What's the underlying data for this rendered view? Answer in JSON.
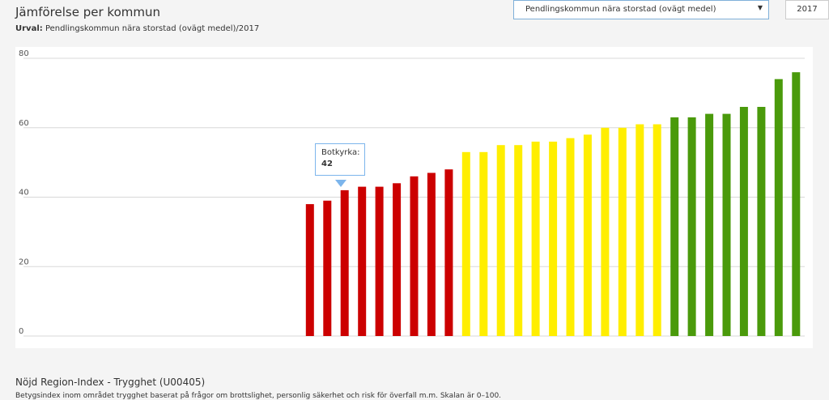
{
  "header": {
    "title": "Jämförelse per kommun",
    "subtitle_label": "Urval:",
    "subtitle_value": "Pendlingskommun nära storstad (ovägt medel)/2017"
  },
  "controls": {
    "group_select": "Pendlingskommun nära storstad (ovägt medel)",
    "year_select": "2017"
  },
  "tooltip": {
    "name": "Botkyrka:",
    "value": "42"
  },
  "footer": {
    "title": "Nöjd Region-Index - Trygghet (U00405)",
    "text": "Betygsindex inom området trygghet baserat på frågor om brottslighet, personlig säkerhet och risk för överfall m.m. Skalan är 0–100."
  },
  "chart_data": {
    "type": "bar",
    "title": "",
    "xlabel": "",
    "ylabel": "",
    "ylim": [
      0,
      80
    ],
    "yticks": [
      0,
      20,
      40,
      60,
      80
    ],
    "grid": true,
    "colors": {
      "red": "#cc0000",
      "yellow": "#ffee00",
      "green": "#4a9a0b"
    },
    "values": [
      null,
      null,
      null,
      null,
      null,
      null,
      null,
      null,
      null,
      null,
      null,
      null,
      null,
      null,
      null,
      null,
      38,
      39,
      42,
      43,
      43,
      44,
      46,
      47,
      48,
      53,
      53,
      55,
      55,
      56,
      56,
      57,
      58,
      60,
      60,
      61,
      61,
      63,
      63,
      64,
      64,
      66,
      66,
      74,
      76
    ],
    "color_groups": [
      "none",
      "none",
      "none",
      "none",
      "none",
      "none",
      "none",
      "none",
      "none",
      "none",
      "none",
      "none",
      "none",
      "none",
      "none",
      "none",
      "red",
      "red",
      "red",
      "red",
      "red",
      "red",
      "red",
      "red",
      "red",
      "yellow",
      "yellow",
      "yellow",
      "yellow",
      "yellow",
      "yellow",
      "yellow",
      "yellow",
      "yellow",
      "yellow",
      "yellow",
      "yellow",
      "green",
      "green",
      "green",
      "green",
      "green",
      "green",
      "green",
      "green"
    ]
  }
}
